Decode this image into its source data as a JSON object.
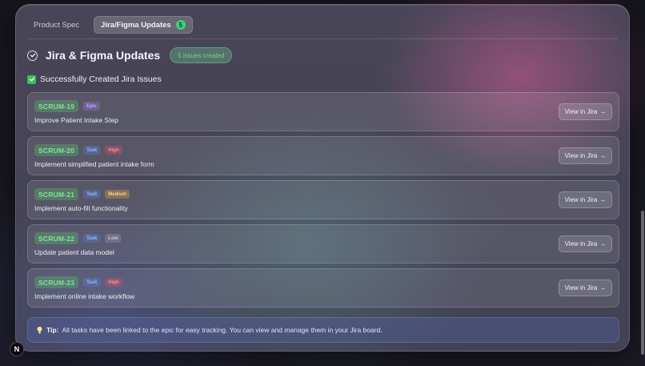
{
  "tabs": [
    {
      "label": "Product Spec",
      "active": false
    },
    {
      "label": "Jira/Figma Updates",
      "active": true,
      "count": "5"
    }
  ],
  "header": {
    "title": "Jira & Figma Updates",
    "status_badge": "5 issues created",
    "status_icon": "check-circle-icon"
  },
  "section": {
    "title": "Successfully Created Jira Issues",
    "icon": "green-check-icon"
  },
  "issues": [
    {
      "key": "SCRUM-19",
      "type": "Epic",
      "priority": "",
      "summary": "Improve Patient Intake Step",
      "action": "View in Jira"
    },
    {
      "key": "SCRUM-20",
      "type": "Task",
      "priority": "High",
      "summary": "Implement simplified patient intake form",
      "action": "View in Jira"
    },
    {
      "key": "SCRUM-21",
      "type": "Task",
      "priority": "Medium",
      "summary": "Implement auto-fill functionality",
      "action": "View in Jira"
    },
    {
      "key": "SCRUM-22",
      "type": "Task",
      "priority": "Low",
      "summary": "Update patient data model",
      "action": "View in Jira"
    },
    {
      "key": "SCRUM-23",
      "type": "Task",
      "priority": "High",
      "summary": "Implement online intake workflow",
      "action": "View in Jira"
    }
  ],
  "tip": {
    "label": "Tip:",
    "text": "All tasks have been linked to the epic for easy tracking. You can view and manage them in your Jira board.",
    "icon": "lightbulb-icon"
  },
  "corner_badge": {
    "label": "N"
  },
  "colors": {
    "accent_green": "#3fcf7a",
    "key_green": "#7fe39a",
    "epic": "#c3a7ff",
    "task": "#9ab6ff",
    "high": "#ff8a9a",
    "medium": "#ffd27a",
    "low": "#c8c8d2"
  }
}
